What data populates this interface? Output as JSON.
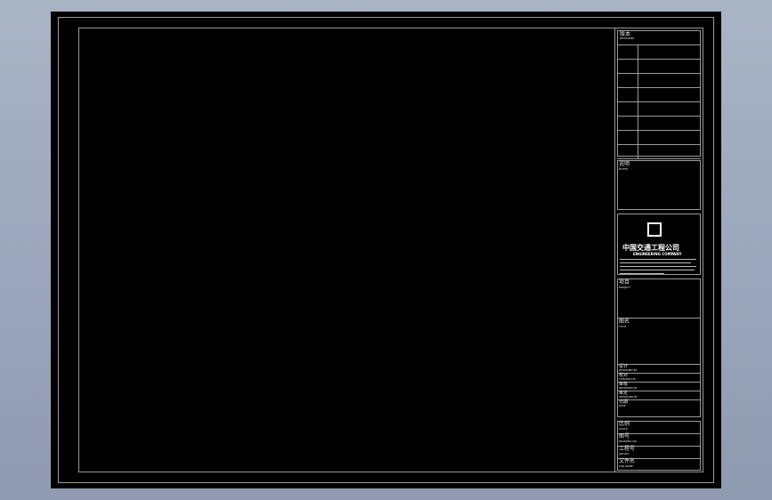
{
  "title_block": {
    "revision": {
      "heading": "版本",
      "subtitle": "REVISIONS"
    },
    "notes": {
      "heading": "说明",
      "subtitle": "NOTES"
    },
    "company": {
      "name_cn": "中国交通工程公司",
      "name_en": "ENGINEERING COMPANY"
    },
    "project": {
      "heading": "项目",
      "subtitle": "PROJECT"
    },
    "drawing_title": {
      "heading": "图名",
      "subtitle": "TITLE"
    },
    "signoff": [
      {
        "cn": "设计",
        "en": "DESIGNED BY"
      },
      {
        "cn": "校对",
        "en": "CHECKED BY"
      },
      {
        "cn": "审核",
        "en": "REVIEWED BY"
      },
      {
        "cn": "审定",
        "en": "APPROVED BY"
      },
      {
        "cn": "日期",
        "en": "DATE"
      }
    ],
    "bottom": [
      {
        "cn": "比例",
        "en": "SCALE"
      },
      {
        "cn": "图号",
        "en": "DRAWING NO."
      },
      {
        "cn": "工程号",
        "en": "JOB NO."
      },
      {
        "cn": "文件名",
        "en": "FILE NAME"
      }
    ]
  }
}
